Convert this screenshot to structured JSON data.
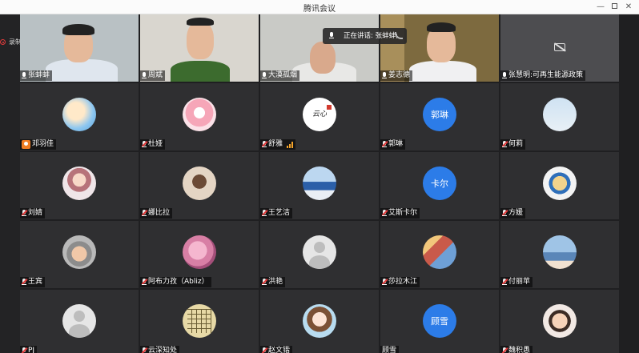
{
  "window": {
    "title": "腾讯会议"
  },
  "recording": {
    "label": "录制中"
  },
  "speaking_now": {
    "text": "正在讲话: 张蚌蚌;"
  },
  "participants": [
    {
      "name": "张蚌蚌",
      "type": "video",
      "mic": "on"
    },
    {
      "name": "周斌",
      "type": "video",
      "mic": "on"
    },
    {
      "name": "大漠孤烟",
      "type": "video",
      "mic": "on"
    },
    {
      "name": "姜志德",
      "type": "video",
      "mic": "on"
    },
    {
      "name": "张慧明:可再生能源政策",
      "type": "camera-off",
      "mic": "on"
    },
    {
      "name": "邓羽佳",
      "type": "avatar",
      "mic": "host"
    },
    {
      "name": "杜娅",
      "type": "avatar",
      "mic": "muted"
    },
    {
      "name": "舒雅",
      "type": "avatar",
      "mic": "speaking"
    },
    {
      "name": "郭琳",
      "type": "letter",
      "avatar_text": "郭琳",
      "mic": "muted"
    },
    {
      "name": "何莉",
      "type": "avatar",
      "mic": "muted"
    },
    {
      "name": "刘婧",
      "type": "avatar",
      "mic": "muted"
    },
    {
      "name": "娜比拉",
      "type": "avatar",
      "mic": "muted"
    },
    {
      "name": "王艺洁",
      "type": "avatar",
      "mic": "muted"
    },
    {
      "name": "艾斯卡尔",
      "type": "letter",
      "avatar_text": "卡尔",
      "mic": "muted"
    },
    {
      "name": "方媛",
      "type": "avatar",
      "mic": "muted"
    },
    {
      "name": "王宾",
      "type": "avatar",
      "mic": "muted"
    },
    {
      "name": "阿布力孜（Abliz）",
      "type": "avatar",
      "mic": "muted"
    },
    {
      "name": "洪艳",
      "type": "avatar",
      "mic": "muted"
    },
    {
      "name": "莎拉木江",
      "type": "avatar",
      "mic": "muted"
    },
    {
      "name": "付丽苹",
      "type": "avatar",
      "mic": "muted"
    },
    {
      "name": "PJ",
      "type": "avatar",
      "mic": "muted"
    },
    {
      "name": "云深知处",
      "type": "avatar",
      "mic": "muted"
    },
    {
      "name": "赵文锴",
      "type": "avatar",
      "mic": "muted"
    },
    {
      "name": "顾雪",
      "type": "letter",
      "avatar_text": "顾雪",
      "mic": "none"
    },
    {
      "name": "魏积愚",
      "type": "avatar",
      "mic": "muted"
    }
  ],
  "colors": {
    "background": "#1f1f21",
    "tile": "#2f2f31",
    "letter_avatar": "#2c7ce8",
    "recording": "#e23b3b",
    "host": "#f07d22"
  }
}
